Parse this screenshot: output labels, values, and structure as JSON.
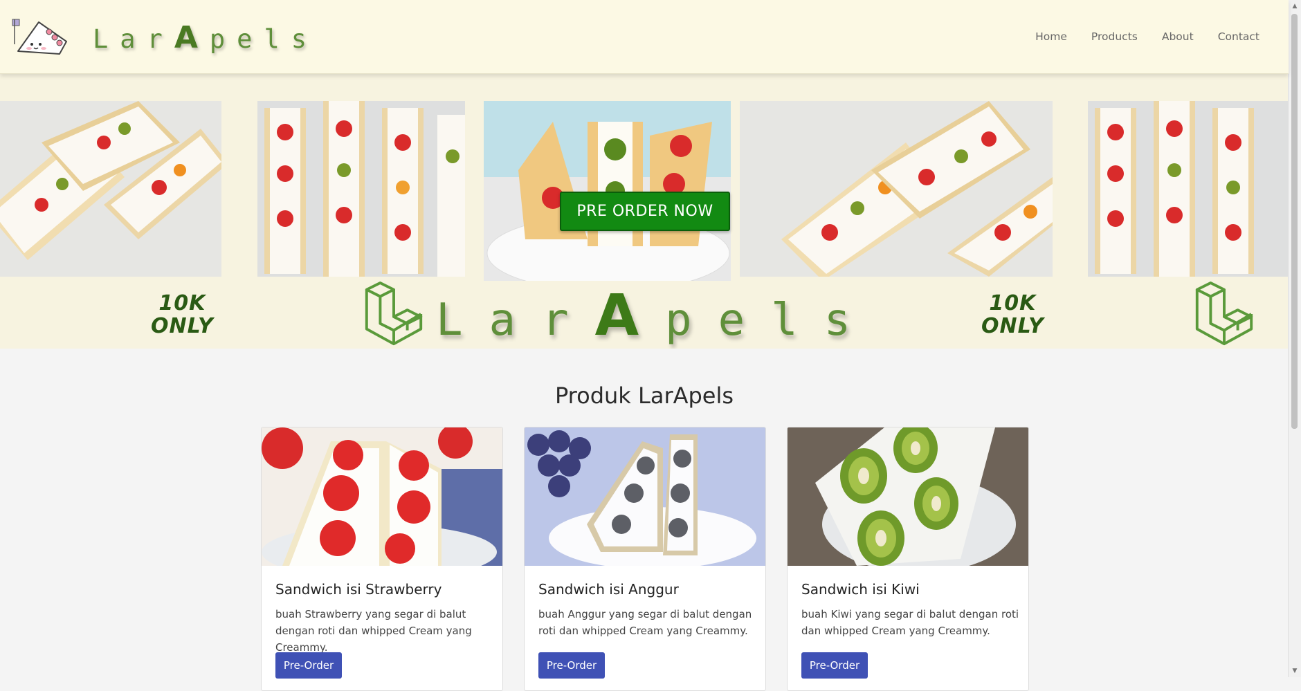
{
  "brand": {
    "prefix": "Lar",
    "a": "A",
    "suffix": "pels"
  },
  "nav": {
    "home": "Home",
    "products": "Products",
    "about": "About",
    "contact": "Contact"
  },
  "hero": {
    "cta_label": "PRE ORDER NOW",
    "promo_line1": "10K",
    "promo_line2": "ONLY",
    "logo_prefix": "Lar",
    "logo_a": "A",
    "logo_suffix": "pels"
  },
  "products": {
    "title": "Produk LarApels",
    "items": [
      {
        "name": "Sandwich isi Strawberry",
        "desc": "buah Strawberry yang segar di balut dengan roti dan whipped Cream yang Creammy.",
        "button": "Pre-Order"
      },
      {
        "name": "Sandwich isi Anggur",
        "desc": "buah Anggur yang segar di balut dengan roti dan whipped Cream yang Creammy.",
        "button": "Pre-Order"
      },
      {
        "name": "Sandwich isi Kiwi",
        "desc": "buah Kiwi yang segar di balut dengan roti dan whipped Cream yang Creammy.",
        "button": "Pre-Order"
      }
    ]
  },
  "colors": {
    "nav_bg": "#fcf9e4",
    "brand_green": "#5f8f3a",
    "cta_green": "#128a12",
    "button_blue": "#3f51b5",
    "page_bg": "#f4f4f4"
  }
}
